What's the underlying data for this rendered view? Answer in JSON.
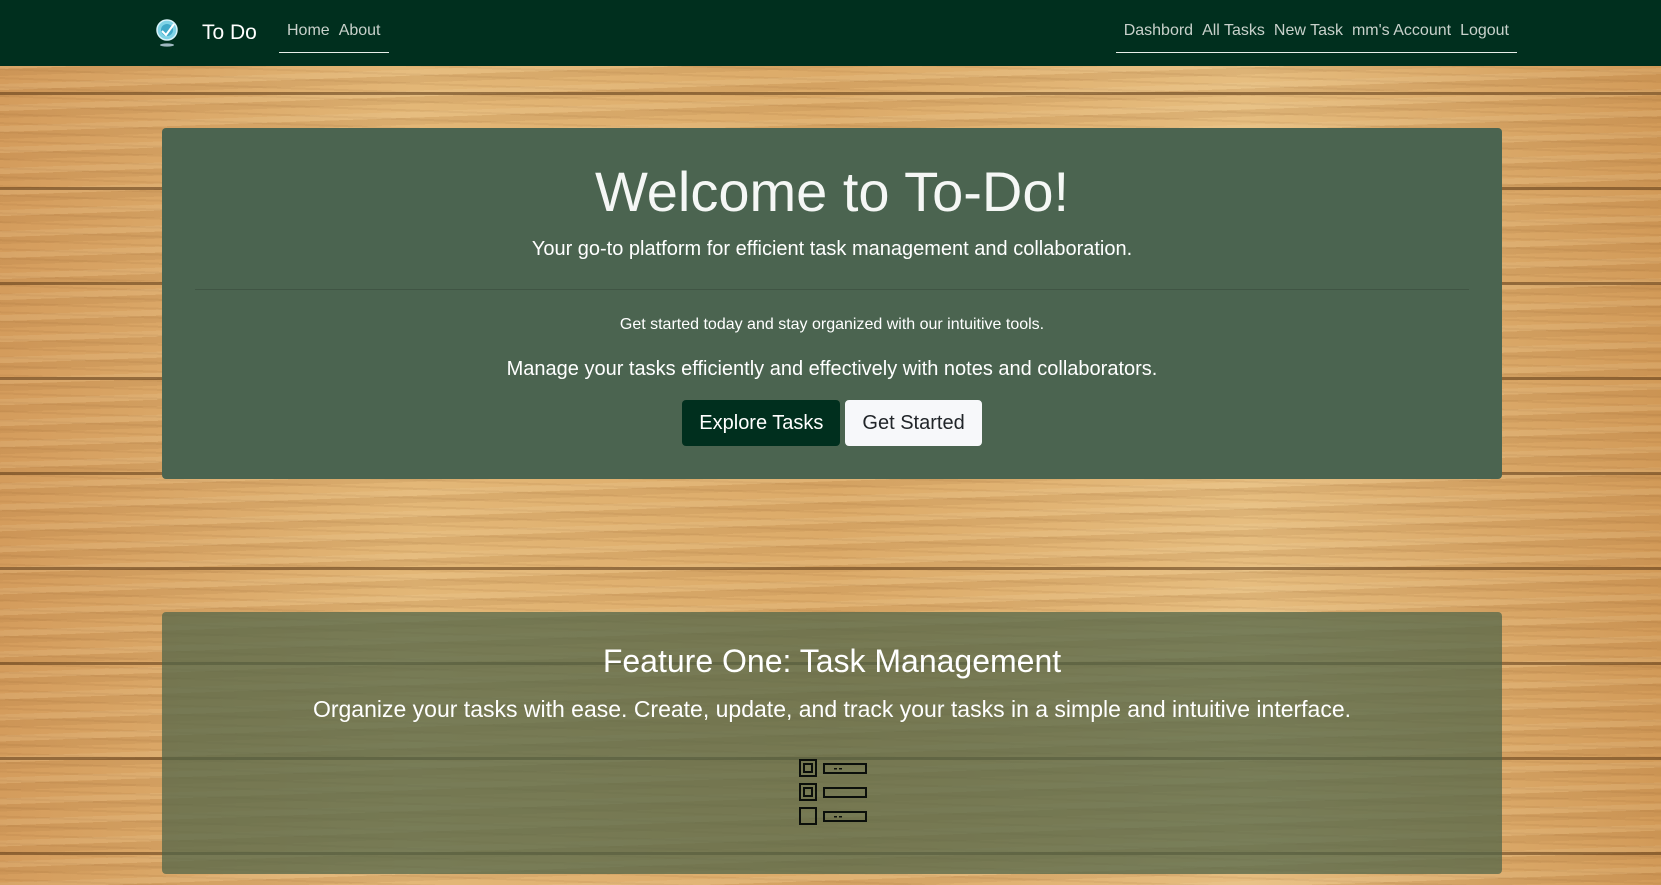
{
  "navbar": {
    "brand": "To Do",
    "left_links": [
      "Home",
      "About"
    ],
    "right_links": [
      "Dashbord",
      "All Tasks",
      "New Task",
      "mm's Account",
      "Logout"
    ]
  },
  "hero": {
    "title": "Welcome to To-Do!",
    "lead": "Your go-to platform for efficient task management and collaboration.",
    "small": "Get started today and stay organized with our intuitive tools.",
    "manage": "Manage your tasks efficiently and effectively with notes and collaborators.",
    "explore_button": "Explore Tasks",
    "get_started_button": "Get Started"
  },
  "feature": {
    "title": "Feature One: Task Management",
    "text": "Organize your tasks with ease. Create, update, and track your tasks in a simple and intuitive interface.",
    "icon": "task-list-icon"
  },
  "colors": {
    "navbar": "#002f1e",
    "hero_panel": "#4b6450",
    "feature_panel": "#4e6448",
    "primary_button": "#002f1e",
    "secondary_button": "#f7f8fa"
  }
}
